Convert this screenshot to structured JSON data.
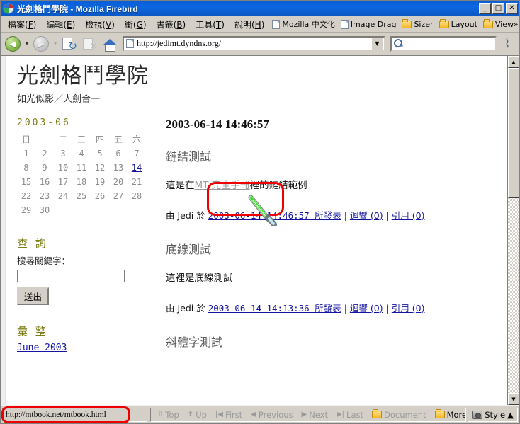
{
  "window": {
    "title": "光劍格鬥學院 - Mozilla Firebird",
    "minimize_label": "_",
    "maximize_label": "□",
    "close_label": "✕"
  },
  "menubar": {
    "items": [
      {
        "label": "檔案",
        "mnemonic": "F"
      },
      {
        "label": "編輯",
        "mnemonic": "E"
      },
      {
        "label": "檢視",
        "mnemonic": "V"
      },
      {
        "label": "衝",
        "mnemonic": "G"
      },
      {
        "label": "書籤",
        "mnemonic": "B"
      },
      {
        "label": "工具",
        "mnemonic": "T"
      },
      {
        "label": "說明",
        "mnemonic": "H"
      }
    ],
    "bookmarks": [
      {
        "label": "Mozilla 中文化",
        "icon": "page-icon"
      },
      {
        "label": "Image Drag",
        "icon": "page-icon"
      },
      {
        "label": "Sizer",
        "icon": "folder-icon"
      },
      {
        "label": "Layout",
        "icon": "folder-icon"
      },
      {
        "label": "View»",
        "icon": "folder-icon"
      }
    ]
  },
  "navbar": {
    "back_glyph": "◀",
    "forward_glyph": "▶",
    "caret_glyph": "▾",
    "url": "http://jedimt.dyndns.org/",
    "url_dropdown_glyph": "▼",
    "search_placeholder": "",
    "search_value": ""
  },
  "page": {
    "site_title": "光劍格鬥學院",
    "site_tagline": "如光似影／人劍合一",
    "sidebar": {
      "calendar": {
        "title": "2003-06",
        "weekdays": [
          "日",
          "一",
          "二",
          "三",
          "四",
          "五",
          "六"
        ],
        "weeks": [
          [
            "1",
            "2",
            "3",
            "4",
            "5",
            "6",
            "7"
          ],
          [
            "8",
            "9",
            "10",
            "11",
            "12",
            "13",
            "14"
          ],
          [
            "15",
            "16",
            "17",
            "18",
            "19",
            "20",
            "21"
          ],
          [
            "22",
            "23",
            "24",
            "25",
            "26",
            "27",
            "28"
          ],
          [
            "29",
            "30",
            "",
            "",
            "",
            "",
            ""
          ]
        ],
        "linked_day": "14"
      },
      "search": {
        "heading": "查 詢",
        "label": "搜尋關鍵字：",
        "value": "",
        "submit_label": "送出"
      },
      "archive": {
        "heading": "彙 整",
        "links": [
          "June 2003"
        ]
      }
    },
    "main": {
      "date_header": "2003-06-14 14:46:57",
      "posts": [
        {
          "title": "鏈結測試",
          "body_before": "這是在",
          "body_link": "MT 完全手冊",
          "body_after": "裡的鏈結範例",
          "footer_by": "由 Jedi 於",
          "footer_time": "2003-06-14 14:46:57 所發表",
          "footer_sep": "|",
          "footer_comments": "迴響 (0)",
          "footer_trackbacks": "引用 (0)"
        },
        {
          "title": "底線測試",
          "body_before": "這裡是",
          "body_underline": "底線",
          "body_after": "測試",
          "footer_by": "由 Jedi 於",
          "footer_time": "2003-06-14 14:13:36 所發表",
          "footer_sep": "|",
          "footer_comments": "迴響 (0)",
          "footer_trackbacks": "引用 (0)"
        },
        {
          "title": "斜體字測試"
        }
      ]
    }
  },
  "statusbar": {
    "status_url": "http://mtbook.net/mtbook.html",
    "nav_items": [
      {
        "label": "Top",
        "glyph": "⇧",
        "state": "dim"
      },
      {
        "label": "Up",
        "glyph": "⬆",
        "state": "dim"
      },
      {
        "label": "First",
        "glyph": "|◀",
        "state": "dim"
      },
      {
        "label": "Previous",
        "glyph": "◀",
        "state": "dim"
      },
      {
        "label": "Next",
        "glyph": "▶",
        "state": "dim"
      },
      {
        "label": "Last",
        "glyph": "▶|",
        "state": "dim"
      },
      {
        "label": "Document",
        "glyph": "folder-icon",
        "state": "dim"
      },
      {
        "label": "More",
        "glyph": "folder-icon",
        "state": "on"
      }
    ],
    "style_label": "Style",
    "style_caret": "▲"
  },
  "colors": {
    "titlebar_blue": "#0c66e0",
    "link_blue": "#1414a0",
    "heading_olive": "#7d7d15",
    "highlight_red": "#ee0000",
    "saber_green": "#33dd22",
    "chrome_gray": "#d4d0c8"
  }
}
